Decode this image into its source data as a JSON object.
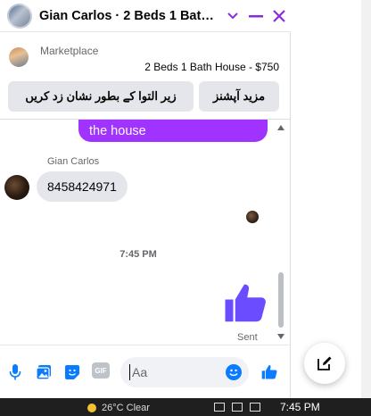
{
  "header": {
    "title": "Gian Carlos · 2 Beds 1 Bath...",
    "icons": [
      "chevron-down-icon",
      "minimize-icon",
      "close-icon"
    ],
    "accent": "#8a2be2"
  },
  "marketplace": {
    "label": "Marketplace",
    "listing": "2 Beds 1 Bath House - $750"
  },
  "actions": {
    "more_options": "مزید آپشنز",
    "mark_as_sold": "زیر التوا کے بطور نشان زد کریں"
  },
  "messages": {
    "outgoing_partial": "the house",
    "sender_name": "Gian Carlos",
    "incoming_text": "8458424971",
    "time": "7:45 PM",
    "sent_status": "Sent"
  },
  "composer": {
    "placeholder": "Aa",
    "gif_label": "GIF",
    "icons": [
      "microphone-icon",
      "photo-icon",
      "sticker-icon",
      "gif-icon",
      "emoji-icon",
      "like-icon"
    ]
  },
  "taskbar": {
    "weather": "26°C Clear",
    "clock": "7:45 PM"
  },
  "colors": {
    "brand_blue": "#0a7cff",
    "message_purple": "#a033ff",
    "like_purple": "#6c4cff"
  }
}
